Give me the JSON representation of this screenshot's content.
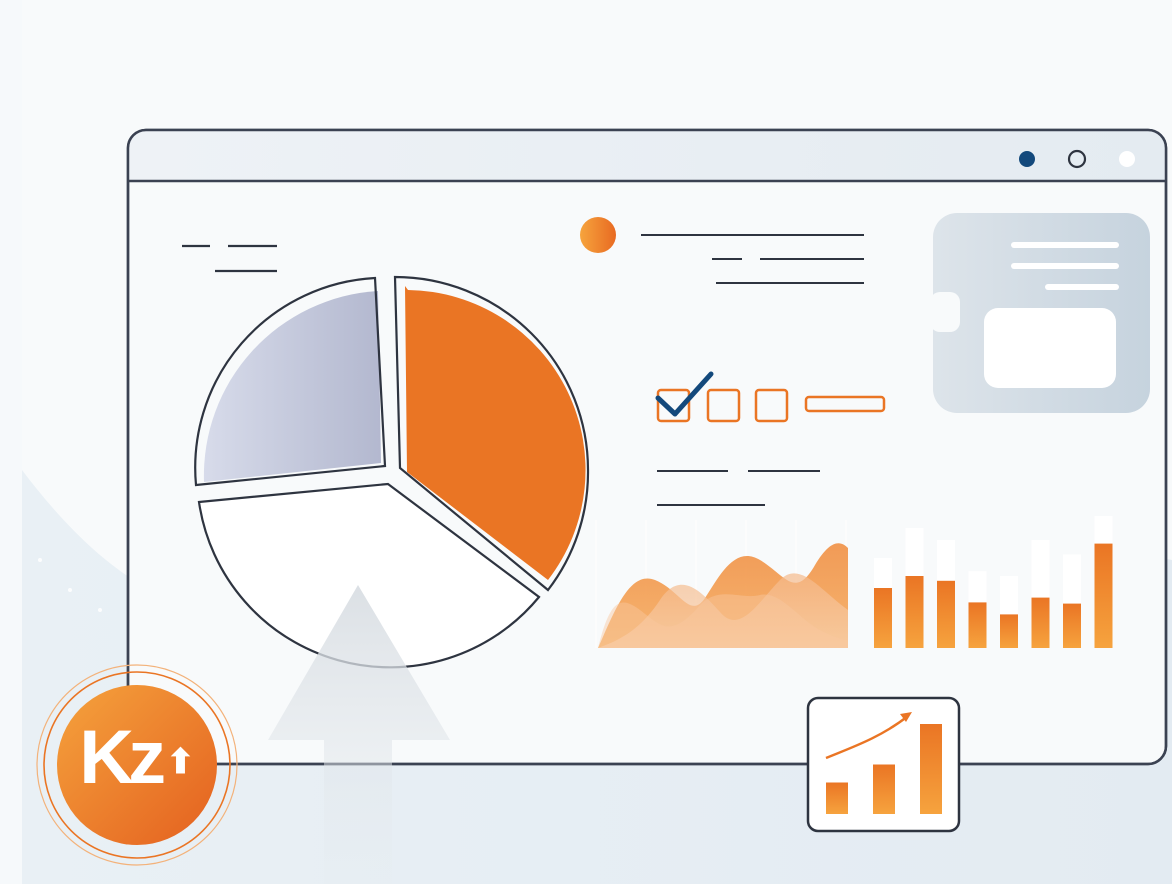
{
  "badge": {
    "label": "Kz",
    "icon": "arrow-up-icon"
  },
  "window_controls": [
    "dot-filled-icon",
    "dot-outline-icon",
    "dot-white-icon"
  ],
  "checkboxes": [
    {
      "checked": true
    },
    {
      "checked": false
    },
    {
      "checked": false
    }
  ],
  "pie_chart": {
    "slices": [
      {
        "name": "",
        "share": 0.36,
        "color": "#ea7524"
      },
      {
        "name": "",
        "share": 0.39,
        "color": "#ffffff"
      },
      {
        "name": "",
        "share": 0.25,
        "color": "#c3c7db"
      }
    ]
  },
  "bar_chart": {
    "values": [
      0.5,
      0.6,
      0.56,
      0.38,
      0.28,
      0.42,
      0.37,
      0.87
    ],
    "background_values": [
      0.75,
      1.0,
      0.9,
      0.64,
      0.6,
      0.9,
      0.78,
      1.1
    ]
  },
  "trend_icon": {
    "bars": [
      0.35,
      0.55,
      1.0
    ]
  },
  "colors": {
    "accent": "#ea7524",
    "accent_light": "#f5a34d",
    "navy": "#13497c",
    "outline": "#3b4252",
    "panel": "#c9d5df"
  }
}
